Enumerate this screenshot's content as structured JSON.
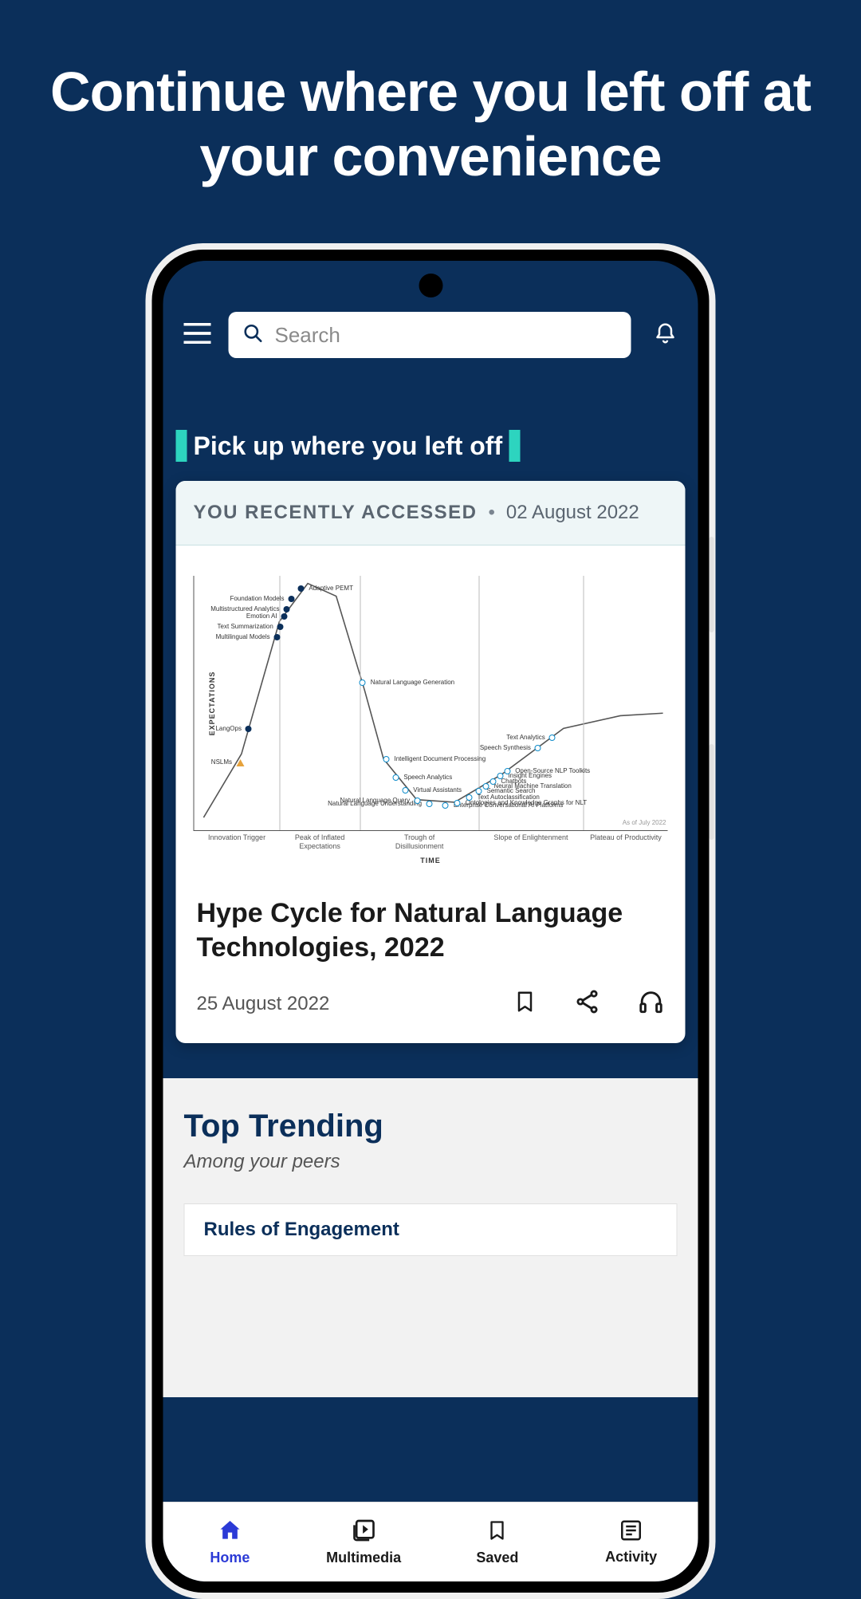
{
  "promo": {
    "headline": "Continue where you left off at your convenience"
  },
  "header": {
    "search_placeholder": "Search"
  },
  "recent": {
    "heading": "Pick up where you left off",
    "badge": "YOU RECENTLY ACCESSED",
    "accessed_date": "02 August 2022",
    "card_title": "Hype Cycle for Natural Language Technologies, 2022",
    "card_date": "25 August 2022"
  },
  "trending": {
    "title": "Top Trending",
    "subtitle": "Among your peers",
    "item1_title": "Rules of Engagement"
  },
  "nav": {
    "home": "Home",
    "multimedia": "Multimedia",
    "saved": "Saved",
    "activity": "Activity"
  },
  "chart_data": {
    "type": "line",
    "title": "Hype Cycle for Natural Language Technologies, 2022",
    "xlabel": "TIME",
    "ylabel": "EXPECTATIONS",
    "footnote": "As of July 2022",
    "phases": [
      "Innovation Trigger",
      "Peak of Inflated Expectations",
      "Trough of Disillusionment",
      "Slope of Enlightenment",
      "Plateau of Productivity"
    ],
    "phase_boundaries_x": [
      0,
      0.18,
      0.35,
      0.6,
      0.82,
      1.0
    ],
    "curve": [
      {
        "x": 0.02,
        "y": 0.05
      },
      {
        "x": 0.1,
        "y": 0.3
      },
      {
        "x": 0.18,
        "y": 0.82
      },
      {
        "x": 0.24,
        "y": 0.97
      },
      {
        "x": 0.3,
        "y": 0.92
      },
      {
        "x": 0.36,
        "y": 0.55
      },
      {
        "x": 0.4,
        "y": 0.28
      },
      {
        "x": 0.47,
        "y": 0.12
      },
      {
        "x": 0.55,
        "y": 0.11
      },
      {
        "x": 0.65,
        "y": 0.22
      },
      {
        "x": 0.78,
        "y": 0.4
      },
      {
        "x": 0.9,
        "y": 0.45
      },
      {
        "x": 0.99,
        "y": 0.46
      }
    ],
    "points": [
      {
        "name": "NSLMs",
        "x": 0.095,
        "y": 0.27,
        "style": "triangle",
        "label_side": "left"
      },
      {
        "name": "LangOps",
        "x": 0.115,
        "y": 0.4,
        "style": "dark",
        "label_side": "left"
      },
      {
        "name": "Multilingual Models",
        "x": 0.175,
        "y": 0.76,
        "style": "dark",
        "label_side": "left"
      },
      {
        "name": "Text Summarization",
        "x": 0.182,
        "y": 0.8,
        "style": "dark",
        "label_side": "left"
      },
      {
        "name": "Emotion AI",
        "x": 0.19,
        "y": 0.84,
        "style": "dark",
        "label_side": "left"
      },
      {
        "name": "Multistructured Analytics",
        "x": 0.195,
        "y": 0.87,
        "style": "dark",
        "label_side": "left"
      },
      {
        "name": "Foundation Models",
        "x": 0.205,
        "y": 0.91,
        "style": "dark",
        "label_side": "left"
      },
      {
        "name": "Adaptive PEMT",
        "x": 0.225,
        "y": 0.95,
        "style": "dark",
        "label_side": "right"
      },
      {
        "name": "Natural Language Generation",
        "x": 0.355,
        "y": 0.58,
        "style": "light",
        "label_side": "right"
      },
      {
        "name": "Intelligent Document Processing",
        "x": 0.405,
        "y": 0.28,
        "style": "light",
        "label_side": "right"
      },
      {
        "name": "Speech Analytics",
        "x": 0.425,
        "y": 0.21,
        "style": "light",
        "label_side": "right"
      },
      {
        "name": "Virtual Assistants",
        "x": 0.445,
        "y": 0.16,
        "style": "light",
        "label_side": "right"
      },
      {
        "name": "Natural Language Query",
        "x": 0.47,
        "y": 0.12,
        "style": "light",
        "label_side": "left"
      },
      {
        "name": "Natural Language Understanding",
        "x": 0.495,
        "y": 0.105,
        "style": "light",
        "label_side": "left"
      },
      {
        "name": "Enterprise Conversational AI Platforms",
        "x": 0.53,
        "y": 0.1,
        "style": "light",
        "label_side": "right"
      },
      {
        "name": "Ontologies and Knowledge Graphs for NLT",
        "x": 0.555,
        "y": 0.11,
        "style": "light",
        "label_side": "right"
      },
      {
        "name": "Text Autoclassification",
        "x": 0.58,
        "y": 0.13,
        "style": "light",
        "label_side": "right"
      },
      {
        "name": "Semantic Search",
        "x": 0.6,
        "y": 0.155,
        "style": "light",
        "label_side": "right"
      },
      {
        "name": "Neural Machine Translation",
        "x": 0.615,
        "y": 0.175,
        "style": "light",
        "label_side": "right"
      },
      {
        "name": "Chatbots",
        "x": 0.63,
        "y": 0.195,
        "style": "light",
        "label_side": "right"
      },
      {
        "name": "Insight Engines",
        "x": 0.645,
        "y": 0.215,
        "style": "light",
        "label_side": "right"
      },
      {
        "name": "Open-Source NLP Toolkits",
        "x": 0.66,
        "y": 0.235,
        "style": "light",
        "label_side": "right"
      },
      {
        "name": "Speech Synthesis",
        "x": 0.725,
        "y": 0.325,
        "style": "light",
        "label_side": "left"
      },
      {
        "name": "Text Analytics",
        "x": 0.755,
        "y": 0.365,
        "style": "light",
        "label_side": "left"
      }
    ]
  }
}
